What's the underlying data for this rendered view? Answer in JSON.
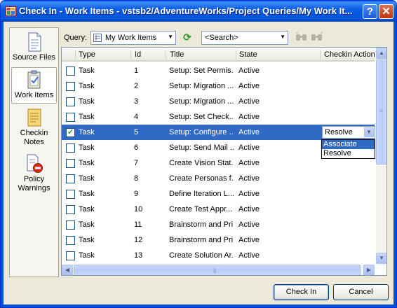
{
  "window": {
    "title": "Check In - Work Items - vstsb2/AdventureWorks/Project Queries/My Work It...",
    "help_label": "?",
    "close_label": "✕"
  },
  "sidebar": {
    "items": [
      {
        "label": "Source Files",
        "icon": "document-icon",
        "selected": false
      },
      {
        "label": "Work Items",
        "icon": "clipboard-icon",
        "selected": true
      },
      {
        "label": "Checkin Notes",
        "icon": "notes-icon",
        "selected": false
      },
      {
        "label": "Policy Warnings",
        "icon": "warning-icon",
        "selected": false
      }
    ]
  },
  "toolbar": {
    "query_label": "Query:",
    "query_value": "My Work Items",
    "search_value": "<Search>"
  },
  "grid": {
    "columns": [
      "Type",
      "Id",
      "Title",
      "State",
      "Checkin Action"
    ],
    "rows": [
      {
        "checked": false,
        "type": "Task",
        "id": "1",
        "title": "Setup: Set Permis...",
        "state": "Active",
        "action": ""
      },
      {
        "checked": false,
        "type": "Task",
        "id": "2",
        "title": "Setup: Migration ...",
        "state": "Active",
        "action": ""
      },
      {
        "checked": false,
        "type": "Task",
        "id": "3",
        "title": "Setup: Migration ...",
        "state": "Active",
        "action": ""
      },
      {
        "checked": false,
        "type": "Task",
        "id": "4",
        "title": "Setup: Set Check...",
        "state": "Active",
        "action": ""
      },
      {
        "checked": true,
        "type": "Task",
        "id": "5",
        "title": "Setup: Configure ...",
        "state": "Active",
        "action": "Resolve"
      },
      {
        "checked": false,
        "type": "Task",
        "id": "6",
        "title": "Setup: Send Mail ...",
        "state": "Active",
        "action": ""
      },
      {
        "checked": false,
        "type": "Task",
        "id": "7",
        "title": "Create Vision Stat...",
        "state": "Active",
        "action": ""
      },
      {
        "checked": false,
        "type": "Task",
        "id": "8",
        "title": "Create Personas f...",
        "state": "Active",
        "action": ""
      },
      {
        "checked": false,
        "type": "Task",
        "id": "9",
        "title": "Define Iteration L...",
        "state": "Active",
        "action": ""
      },
      {
        "checked": false,
        "type": "Task",
        "id": "10",
        "title": "Create Test Appr...",
        "state": "Active",
        "action": ""
      },
      {
        "checked": false,
        "type": "Task",
        "id": "11",
        "title": "Brainstorm and Pri...",
        "state": "Active",
        "action": ""
      },
      {
        "checked": false,
        "type": "Task",
        "id": "12",
        "title": "Brainstorm and Pri...",
        "state": "Active",
        "action": ""
      },
      {
        "checked": false,
        "type": "Task",
        "id": "13",
        "title": "Create Solution Ar...",
        "state": "Active",
        "action": ""
      }
    ],
    "action_dropdown": {
      "selected": "Resolve",
      "options": [
        "Associate",
        "Resolve"
      ],
      "highlighted": "Associate"
    }
  },
  "buttons": {
    "check_in": "Check In",
    "cancel": "Cancel"
  }
}
